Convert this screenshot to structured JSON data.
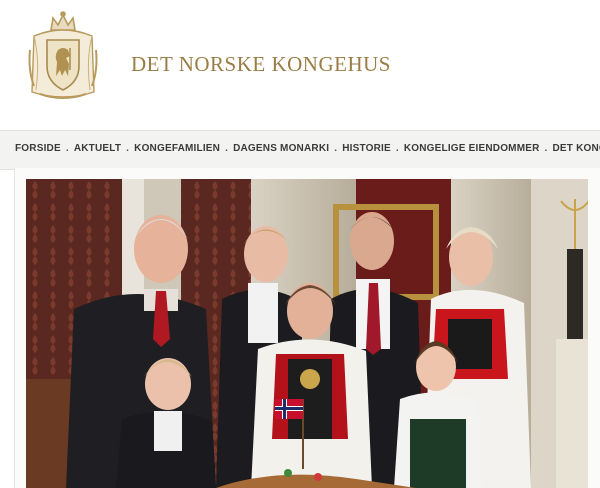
{
  "header": {
    "title": "DET NORSKE KONGEHUS",
    "logo_icon": "royal-coat-of-arms-icon",
    "gold_color": "#9a7d45"
  },
  "nav": {
    "items": [
      {
        "label": "FORSIDE"
      },
      {
        "label": "AKTUELT"
      },
      {
        "label": "KONGEFAMILIEN"
      },
      {
        "label": "DAGENS MONARKI"
      },
      {
        "label": "HISTORIE"
      },
      {
        "label": "KONGELIGE EIENDOMMER"
      },
      {
        "label": "DET KONGELIGE HO"
      }
    ],
    "separator": "."
  },
  "photo": {
    "subject": "royal-family-group-photo"
  }
}
